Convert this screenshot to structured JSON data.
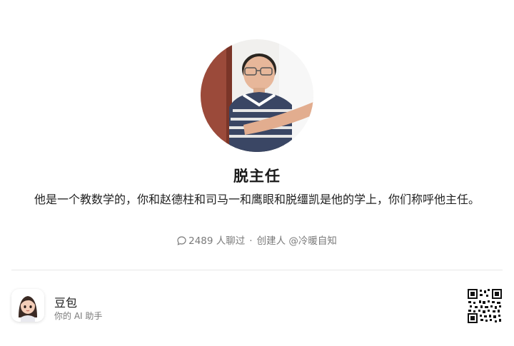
{
  "bot": {
    "name": "脱主任",
    "description": "他是一个教数学的，你和赵德柱和司马一和鹰眼和脱缰凯是他的学上，你们称呼他主任。",
    "chat_count": "2489 人聊过",
    "separator": "·",
    "creator": "创建人 @冷暖自知"
  },
  "app": {
    "name": "豆包",
    "tagline": "你的 AI 助手"
  },
  "icons": {
    "chat": "chat-bubble-icon",
    "qr": "qr-code-icon",
    "app": "doubao-avatar-icon"
  }
}
